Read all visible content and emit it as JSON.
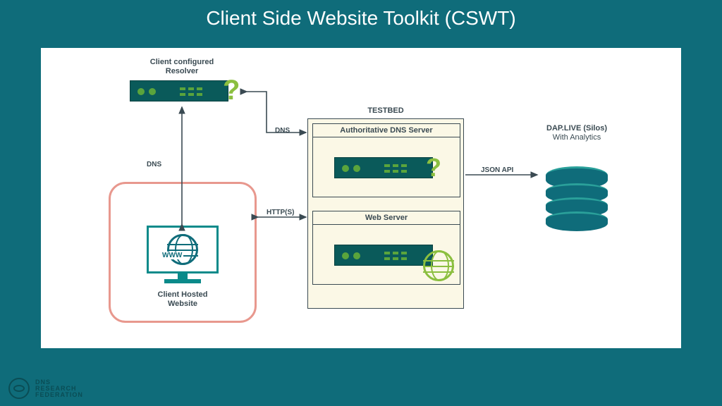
{
  "title": "Client Side Website Toolkit (CSWT)",
  "nodes": {
    "resolver_label": "Client configured\nResolver",
    "client_label": "Client Hosted\nWebsite",
    "client_badge": "WWW",
    "testbed_title": "TESTBED",
    "dns_server_label": "Authoritative DNS Server",
    "web_server_label": "Web Server",
    "db_label_top": "DAP.LIVE (Silos)",
    "db_label_sub": "With Analytics"
  },
  "edges": {
    "client_to_resolver": "DNS",
    "resolver_to_dns": "DNS",
    "client_to_web": "HTTP(S)",
    "testbed_to_db": "JSON API"
  },
  "footer": {
    "line1": "DNS",
    "line2": "RESEARCH",
    "line3": "FEDERATION"
  }
}
